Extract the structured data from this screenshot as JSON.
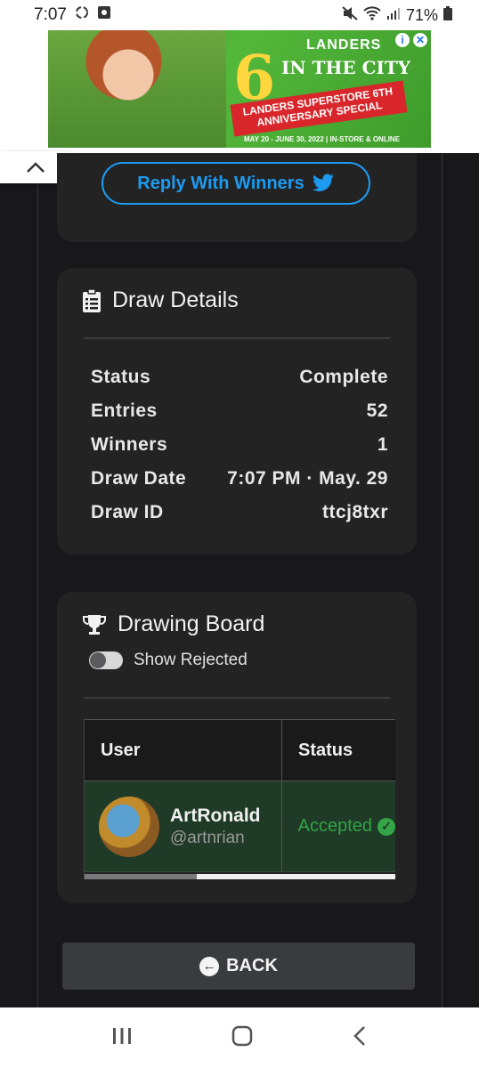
{
  "status_bar": {
    "time": "7:07",
    "battery": "71%"
  },
  "ad": {
    "brand": "LANDERS",
    "big_number": "6",
    "headline": "IN THE CITY",
    "ribbon": "LANDERS SUPERSTORE 6TH ANNIVERSARY SPECIAL",
    "tagline": "MAY 20 - JUNE 30, 2022 | IN-STORE & ONLINE"
  },
  "reply": {
    "label": "Reply With Winners"
  },
  "draw_details": {
    "title": "Draw Details",
    "rows": [
      {
        "label": "Status",
        "value": "Complete"
      },
      {
        "label": "Entries",
        "value": "52"
      },
      {
        "label": "Winners",
        "value": "1"
      },
      {
        "label": "Draw Date",
        "value": "7:07 PM · May. 29"
      },
      {
        "label": "Draw ID",
        "value": "ttcj8txr"
      }
    ]
  },
  "drawing_board": {
    "title": "Drawing Board",
    "toggle_label": "Show Rejected",
    "toggle_on": false,
    "columns": [
      "User",
      "Status"
    ],
    "rows": [
      {
        "name": "ArtRonald",
        "handle": "@artnrian",
        "status": "Accepted"
      }
    ]
  },
  "back": {
    "label": "BACK"
  },
  "colors": {
    "accent": "#1d9bf0",
    "success": "#33a447",
    "card": "#232324"
  }
}
